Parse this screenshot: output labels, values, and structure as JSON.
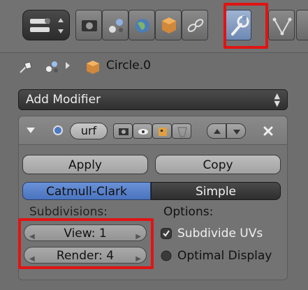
{
  "header": {
    "tabs": [
      {
        "icon": "render-icon"
      },
      {
        "icon": "render-layers-icon"
      },
      {
        "icon": "world-icon"
      },
      {
        "icon": "object-icon"
      },
      {
        "icon": "constraints-icon"
      },
      {
        "icon": "modifiers-wrench-icon",
        "active": true
      },
      {
        "icon": "object-data-icon"
      }
    ]
  },
  "breadcrumb": {
    "object": "Circle.0"
  },
  "add_modifier": {
    "label": "Add Modifier"
  },
  "modifier": {
    "name": "urf",
    "apply_label": "Apply",
    "copy_label": "Copy",
    "subdivision_types": [
      "Catmull-Clark",
      "Simple"
    ],
    "selected_type": "Catmull-Clark",
    "subdivisions_label": "Subdivisions:",
    "view_field": "View: 1",
    "render_field": "Render: 4",
    "options_label": "Options:",
    "subdivide_uvs_label": "Subdivide UVs",
    "subdivide_uvs_checked": true,
    "optimal_display_label": "Optimal Display",
    "optimal_display_checked": false
  },
  "colors": {
    "highlight": "#e01414",
    "accent": "#5a82ca",
    "background": "#6e6e6e"
  }
}
